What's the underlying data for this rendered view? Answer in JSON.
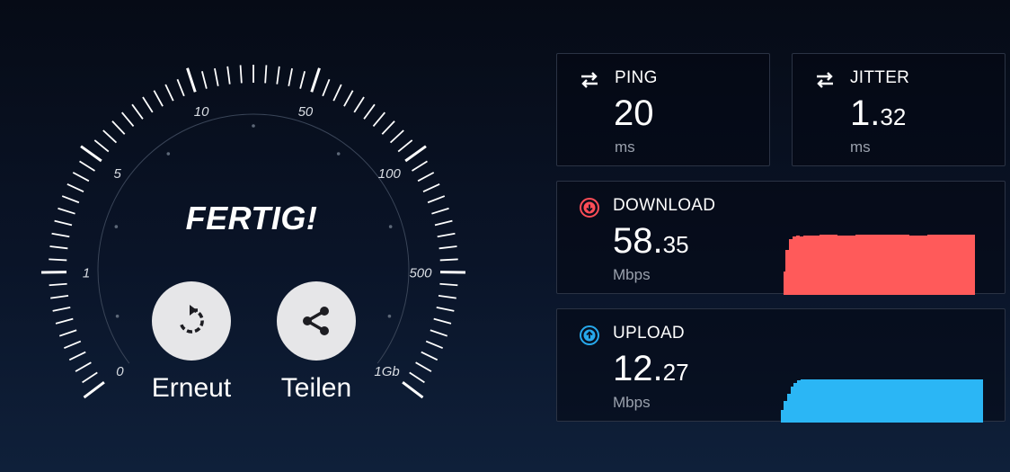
{
  "gauge": {
    "status": "FERTIG!",
    "scale_labels": [
      "0",
      "1",
      "5",
      "10",
      "50",
      "100",
      "500",
      "1Gb"
    ]
  },
  "actions": {
    "retry_label": "Erneut",
    "share_label": "Teilen"
  },
  "ping": {
    "label": "PING",
    "value": "20",
    "decimal": "",
    "unit": "ms"
  },
  "jitter": {
    "label": "JITTER",
    "value": "1.",
    "decimal": "32",
    "unit": "ms"
  },
  "download": {
    "label": "DOWNLOAD",
    "value": "58.",
    "decimal": "35",
    "unit": "Mbps"
  },
  "upload": {
    "label": "UPLOAD",
    "value": "12.",
    "decimal": "27",
    "unit": "Mbps"
  },
  "colors": {
    "download": "#ff5a5a",
    "upload": "#2bb6f5",
    "download_icon": "#ff4d57",
    "upload_icon": "#27a9ec",
    "background": "#0a1428"
  }
}
